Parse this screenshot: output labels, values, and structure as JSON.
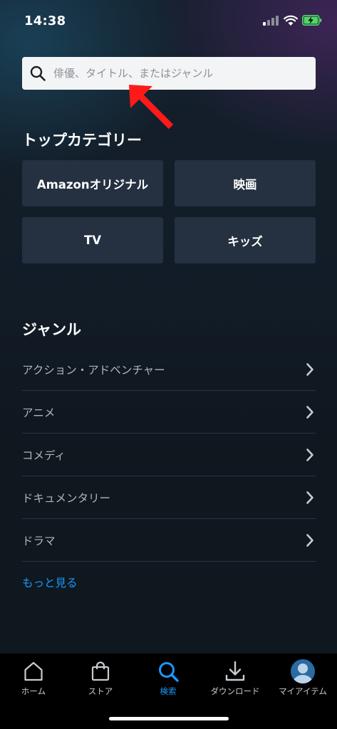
{
  "status_bar": {
    "time": "14:38"
  },
  "search": {
    "placeholder": "俳優、タイトル、またはジャンル"
  },
  "top_categories": {
    "title": "トップカテゴリー",
    "items": [
      {
        "label": "Amazonオリジナル"
      },
      {
        "label": "映画"
      },
      {
        "label": "TV"
      },
      {
        "label": "キッズ"
      }
    ]
  },
  "genres": {
    "title": "ジャンル",
    "items": [
      {
        "label": "アクション・アドベンチャー"
      },
      {
        "label": "アニメ"
      },
      {
        "label": "コメディ"
      },
      {
        "label": "ドキュメンタリー"
      },
      {
        "label": "ドラマ"
      }
    ],
    "more_label": "もっと見る"
  },
  "tab_bar": {
    "tabs": [
      {
        "label": "ホーム",
        "icon": "home-icon"
      },
      {
        "label": "ストア",
        "icon": "shopping-bag-icon"
      },
      {
        "label": "検索",
        "icon": "search-icon",
        "active": true
      },
      {
        "label": "ダウンロード",
        "icon": "download-icon"
      },
      {
        "label": "マイアイテム",
        "icon": "avatar"
      }
    ]
  },
  "colors": {
    "accent": "#1a98ff",
    "annotation_arrow": "#ff1a1a",
    "button_bg": "#253040",
    "background": "#0f171f"
  }
}
